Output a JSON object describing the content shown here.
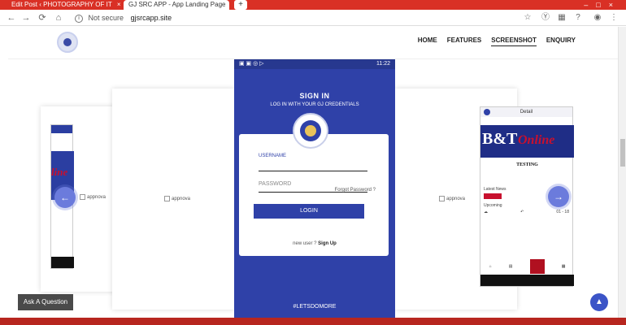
{
  "browser": {
    "tabs": [
      {
        "label": "Edit Post ‹ PHOTOGRAPHY OF IT",
        "close": "×"
      },
      {
        "label": "GJ SRC APP - App Landing Page",
        "close": "×"
      }
    ],
    "new_tab": "+",
    "window_controls": "–□×",
    "security_label": "Not secure",
    "url": "gjsrcapp.site",
    "nav": {
      "back": "←",
      "forward": "→",
      "reload": "⟳",
      "home": "⌂"
    },
    "right_icons": {
      "star": "☆",
      "ext1": "Ⓨ",
      "ext2": "▦",
      "help": "?",
      "account": "◉",
      "menu": "⋮"
    }
  },
  "site": {
    "nav_items": [
      "HOME",
      "FEATURES",
      "SCREENSHOT",
      "ENQUIRY"
    ],
    "active_nav": "SCREENSHOT"
  },
  "carousel": {
    "alt_text": "appnova",
    "prev": "←",
    "next": "→",
    "left_phone_banner": "line"
  },
  "phone": {
    "status_time": "11:22",
    "title": "SIGN IN",
    "subtitle": "LOG IN WITH YOUR GJ CREDENTIALS",
    "username_label": "USERNAME",
    "password_placeholder": "PASSWORD",
    "forgot": "Forgot Password ?",
    "login": "LOGIN",
    "new_user": "new user ?",
    "sign_up": "Sign Up",
    "tagline": "#LETSDOMORE"
  },
  "right_phone": {
    "header": "Detail",
    "banner_bet": "B&T",
    "banner_online": "Online",
    "testing": "TESTING",
    "row1": "Latest News",
    "row2": "Upcoming",
    "stat_date": "01 - 18"
  },
  "ask_question": "Ask A Question",
  "scroll_top": "▲"
}
